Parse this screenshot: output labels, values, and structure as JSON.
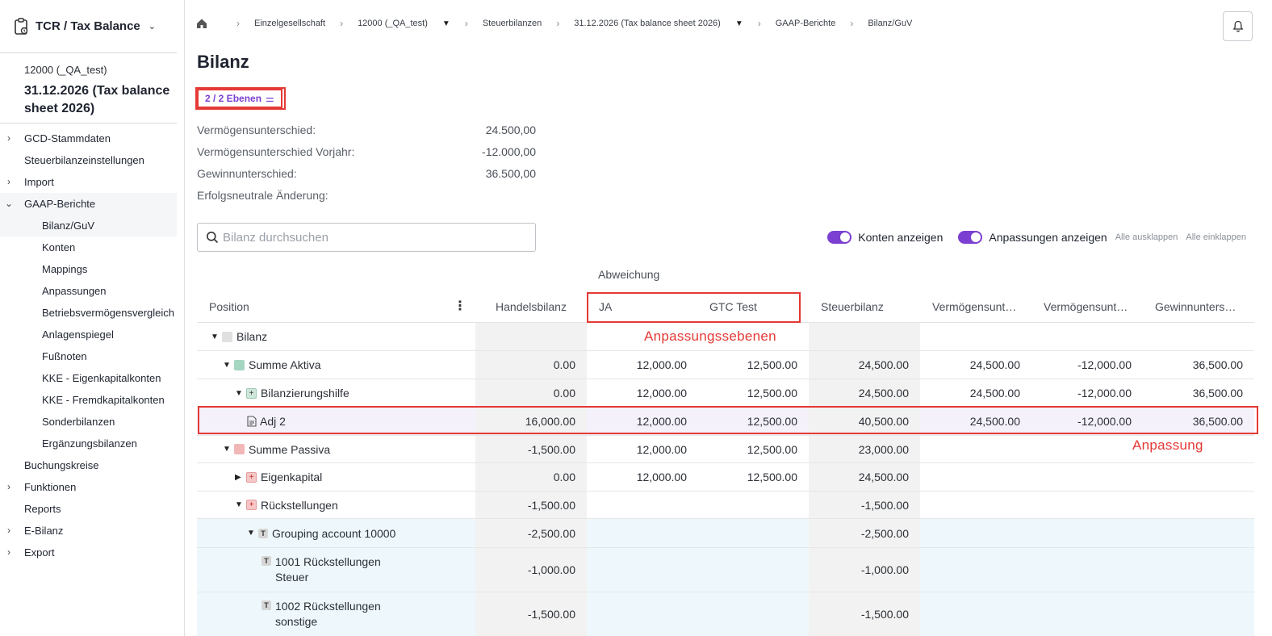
{
  "app": {
    "title": "TCR / Tax Balance"
  },
  "context": {
    "company": "12000 (_QA_test)",
    "period": "31.12.2026 (Tax balance sheet 2026)"
  },
  "sidebar": {
    "items": [
      {
        "label": "GCD-Stammdaten",
        "chev": "›"
      },
      {
        "label": "Steuerbilanzeinstellungen",
        "chev": ""
      },
      {
        "label": "Import",
        "chev": "›"
      },
      {
        "label": "GAAP-Berichte",
        "chev": "⌄"
      },
      {
        "label": "Bilanz/GuV"
      },
      {
        "label": "Konten"
      },
      {
        "label": "Mappings"
      },
      {
        "label": "Anpassungen"
      },
      {
        "label": "Betriebsvermögensvergleich"
      },
      {
        "label": "Anlagenspiegel"
      },
      {
        "label": "Fußnoten"
      },
      {
        "label": "KKE - Eigenkapitalkonten"
      },
      {
        "label": "KKE - Fremdkapitalkonten"
      },
      {
        "label": "Sonderbilanzen"
      },
      {
        "label": "Ergänzungsbilanzen"
      },
      {
        "label": "Buchungskreise",
        "chev": ""
      },
      {
        "label": "Funktionen",
        "chev": "›"
      },
      {
        "label": "Reports",
        "chev": ""
      },
      {
        "label": "E-Bilanz",
        "chev": "›"
      },
      {
        "label": "Export",
        "chev": "›"
      }
    ]
  },
  "breadcrumb": [
    "Einzelgesellschaft",
    "12000 (_QA_test)",
    "Steuerbilanzen",
    "31.12.2026 (Tax balance sheet 2026)",
    "GAAP-Berichte",
    "Bilanz/GuV"
  ],
  "page": {
    "title": "Bilanz",
    "levels_label": "2 / 2 Ebenen"
  },
  "summary": [
    {
      "label": "Vermögensunterschied:",
      "value": "24.500,00"
    },
    {
      "label": "Vermögensunterschied Vorjahr:",
      "value": "-12.000,00"
    },
    {
      "label": "Gewinnunterschied:",
      "value": "36.500,00"
    },
    {
      "label": "Erfolgsneutrale Änderung:",
      "value": ""
    }
  ],
  "search": {
    "placeholder": "Bilanz durchsuchen",
    "value": ""
  },
  "toggles": {
    "show_accounts": "Konten anzeigen",
    "show_adjustments": "Anpassungen anzeigen",
    "expand_all": "Alle ausklappen",
    "collapse_all": "Alle einklappen"
  },
  "table": {
    "group_header": "Abweichung",
    "columns": {
      "position": "Position",
      "hb": "Handelsbilanz",
      "ja": "JA",
      "gtc": "GTC Test",
      "sb": "Steuerbilanz",
      "vu": "Vermögensunt…",
      "vuv": "Vermögensunt…",
      "gu": "Gewinnunters…"
    },
    "rows": [
      {
        "label": "Bilanz",
        "hb": "",
        "ja": "",
        "gtc": "",
        "sb": "",
        "vu": "",
        "vuv": "",
        "gu": ""
      },
      {
        "label": "Summe Aktiva",
        "hb": "0.00",
        "ja": "12,000.00",
        "gtc": "12,500.00",
        "sb": "24,500.00",
        "vu": "24,500.00",
        "vuv": "-12,000.00",
        "gu": "36,500.00"
      },
      {
        "label": "Bilanzierungshilfe",
        "hb": "0.00",
        "ja": "12,000.00",
        "gtc": "12,500.00",
        "sb": "24,500.00",
        "vu": "24,500.00",
        "vuv": "-12,000.00",
        "gu": "36,500.00"
      },
      {
        "label": "Adj 2",
        "hb": "16,000.00",
        "ja": "12,000.00",
        "gtc": "12,500.00",
        "sb": "40,500.00",
        "vu": "24,500.00",
        "vuv": "-12,000.00",
        "gu": "36,500.00"
      },
      {
        "label": "Summe Passiva",
        "hb": "-1,500.00",
        "ja": "12,000.00",
        "gtc": "12,500.00",
        "sb": "23,000.00",
        "vu": "",
        "vuv": "",
        "gu": ""
      },
      {
        "label": "Eigenkapital",
        "hb": "0.00",
        "ja": "12,000.00",
        "gtc": "12,500.00",
        "sb": "24,500.00",
        "vu": "",
        "vuv": "",
        "gu": ""
      },
      {
        "label": "Rückstellungen",
        "hb": "-1,500.00",
        "ja": "",
        "gtc": "",
        "sb": "-1,500.00",
        "vu": "",
        "vuv": "",
        "gu": ""
      },
      {
        "label": "Grouping account 10000",
        "hb": "-2,500.00",
        "ja": "",
        "gtc": "",
        "sb": "-2,500.00",
        "vu": "",
        "vuv": "",
        "gu": ""
      },
      {
        "label1": "1001 Rückstellungen",
        "label2": "Steuer",
        "hb": "-1,000.00",
        "ja": "",
        "gtc": "",
        "sb": "-1,000.00",
        "vu": "",
        "vuv": "",
        "gu": ""
      },
      {
        "label1": "1002 Rückstellungen",
        "label2": "sonstige",
        "hb": "-1,500.00",
        "ja": "",
        "gtc": "",
        "sb": "-1,500.00",
        "vu": "",
        "vuv": "",
        "gu": ""
      }
    ]
  },
  "annotations": {
    "levels": "Anpassungssebenen",
    "adjustment": "Anpassung"
  },
  "colors": {
    "accent": "#7b3fd1",
    "annotation": "#e53935"
  }
}
